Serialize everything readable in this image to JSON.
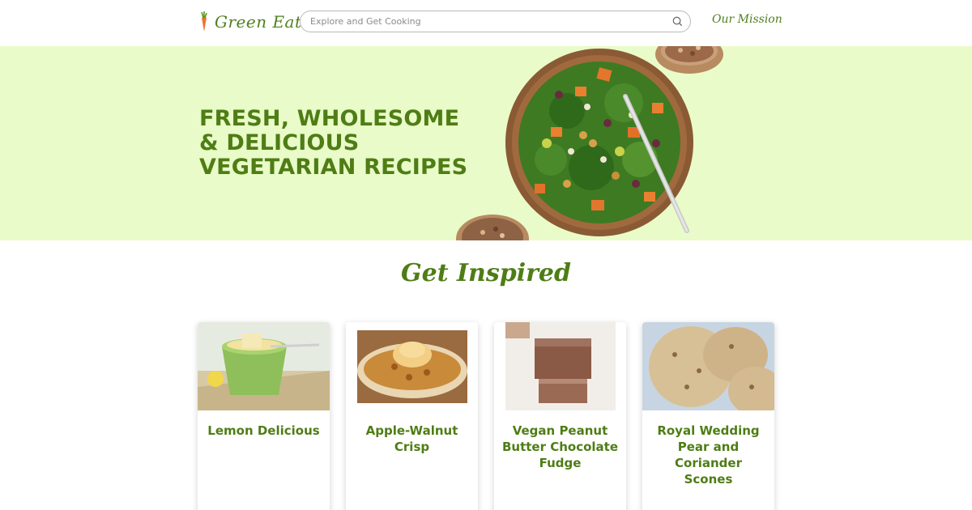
{
  "header": {
    "brand_name": "Green Eats",
    "search_placeholder": "Explore and Get Cooking",
    "nav_link": "Our Mission"
  },
  "hero": {
    "title_lines": [
      "FRESH, WHOLESOME",
      "& DELICIOUS",
      "VEGETARIAN RECIPES"
    ]
  },
  "section": {
    "title": "Get Inspired"
  },
  "cards": [
    {
      "title": "Lemon Delicious"
    },
    {
      "title": "Apple-Walnut Crisp"
    },
    {
      "title": "Vegan Peanut Butter Chocolate Fudge"
    },
    {
      "title": "Royal Wedding Pear and Coriander Scones"
    }
  ],
  "colors": {
    "brand_green": "#4e7d15",
    "hero_background": "#e9fbc8",
    "carrot": "#e8772e"
  }
}
